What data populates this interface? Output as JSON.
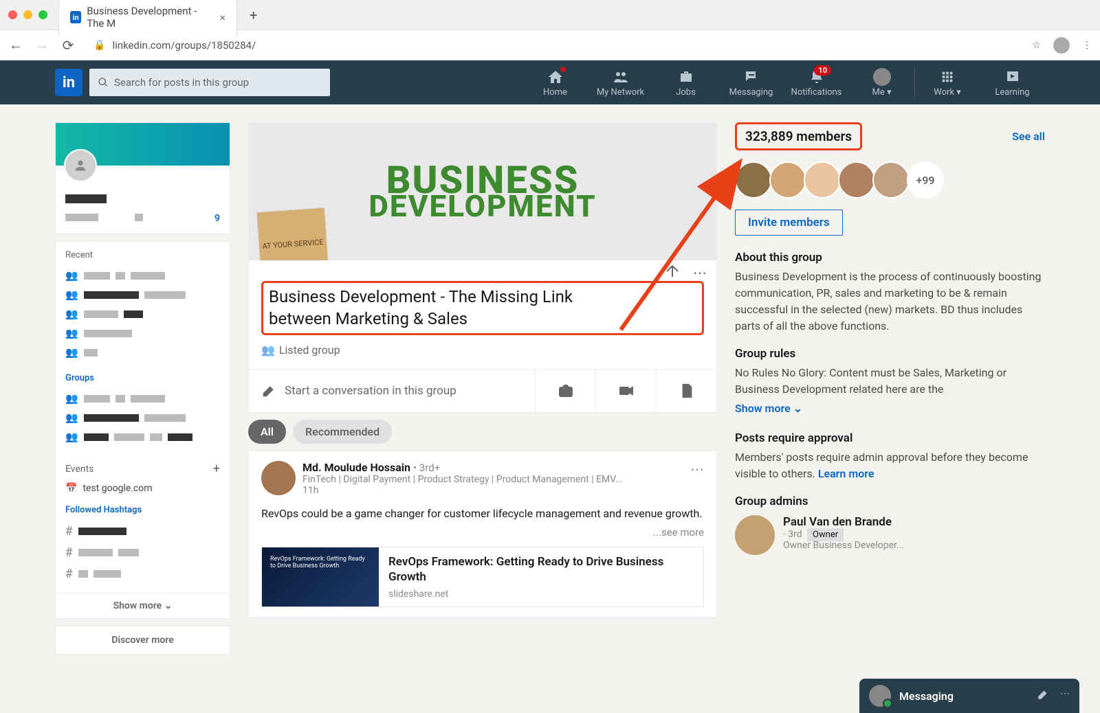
{
  "browser": {
    "tab_title": "Business Development - The M",
    "url": "linkedin.com/groups/1850284/",
    "search_placeholder": "Search for posts in this group"
  },
  "nav": {
    "home": "Home",
    "network": "My Network",
    "jobs": "Jobs",
    "messaging": "Messaging",
    "notifications": "Notifications",
    "notif_badge": "10",
    "me": "Me",
    "work": "Work",
    "learning": "Learning"
  },
  "left": {
    "viewer_count": "9",
    "recent": "Recent",
    "groups": "Groups",
    "events": "Events",
    "event_name": "test google.com",
    "hashtags": "Followed Hashtags",
    "show_more": "Show more",
    "discover": "Discover more"
  },
  "group": {
    "banner_word_big": "BUSINESS",
    "banner_word_sub": "DEVELOPMENT",
    "logo_text": "AT YOUR SERVICE",
    "title": "Business Development - The Missing Link between Marketing & Sales",
    "listed": "Listed group",
    "compose": "Start a conversation in this group",
    "pill_all": "All",
    "pill_rec": "Recommended"
  },
  "post": {
    "author": "Md. Moulude Hossain",
    "degree": "• 3rd+",
    "headline": "FinTech | Digital Payment | Product Strategy | Product Management | EMV...",
    "time": "11h",
    "text": "RevOps could be a game changer for customer lifecycle management and revenue growth.",
    "see_more": "...see more",
    "link_title": "RevOps Framework: Getting Ready to Drive Business Growth",
    "link_thumb": "RevOps Framework: Getting Ready to Drive Business Growth",
    "link_domain": "slideshare.net"
  },
  "right": {
    "members": "323,889 members",
    "see_all": "See all",
    "more_count": "+99",
    "invite": "Invite members",
    "about_hdr": "About this group",
    "about_txt": "Business Development is the process of continuously boosting communication, PR, sales and marketing to be & remain successful in the selected (new) markets. BD thus includes parts of all the above functions.",
    "rules_hdr": "Group rules",
    "rules_txt": "No Rules No Glory: Content must be Sales, Marketing or Business Development related here are the",
    "show_more": "Show more",
    "approval_hdr": "Posts require approval",
    "approval_txt": "Members' posts require admin approval before they become visible to others. ",
    "learn_more": "Learn more",
    "admins_hdr": "Group admins",
    "admin_name": "Paul Van den Brande",
    "admin_degree": "· 3rd",
    "admin_owner": "Owner",
    "admin_role": "Owner Business Developer..."
  },
  "dock": {
    "label": "Messaging"
  },
  "colors": {
    "brand": "#0a66c2",
    "navbg": "#283e4a",
    "annot": "#e84118"
  }
}
